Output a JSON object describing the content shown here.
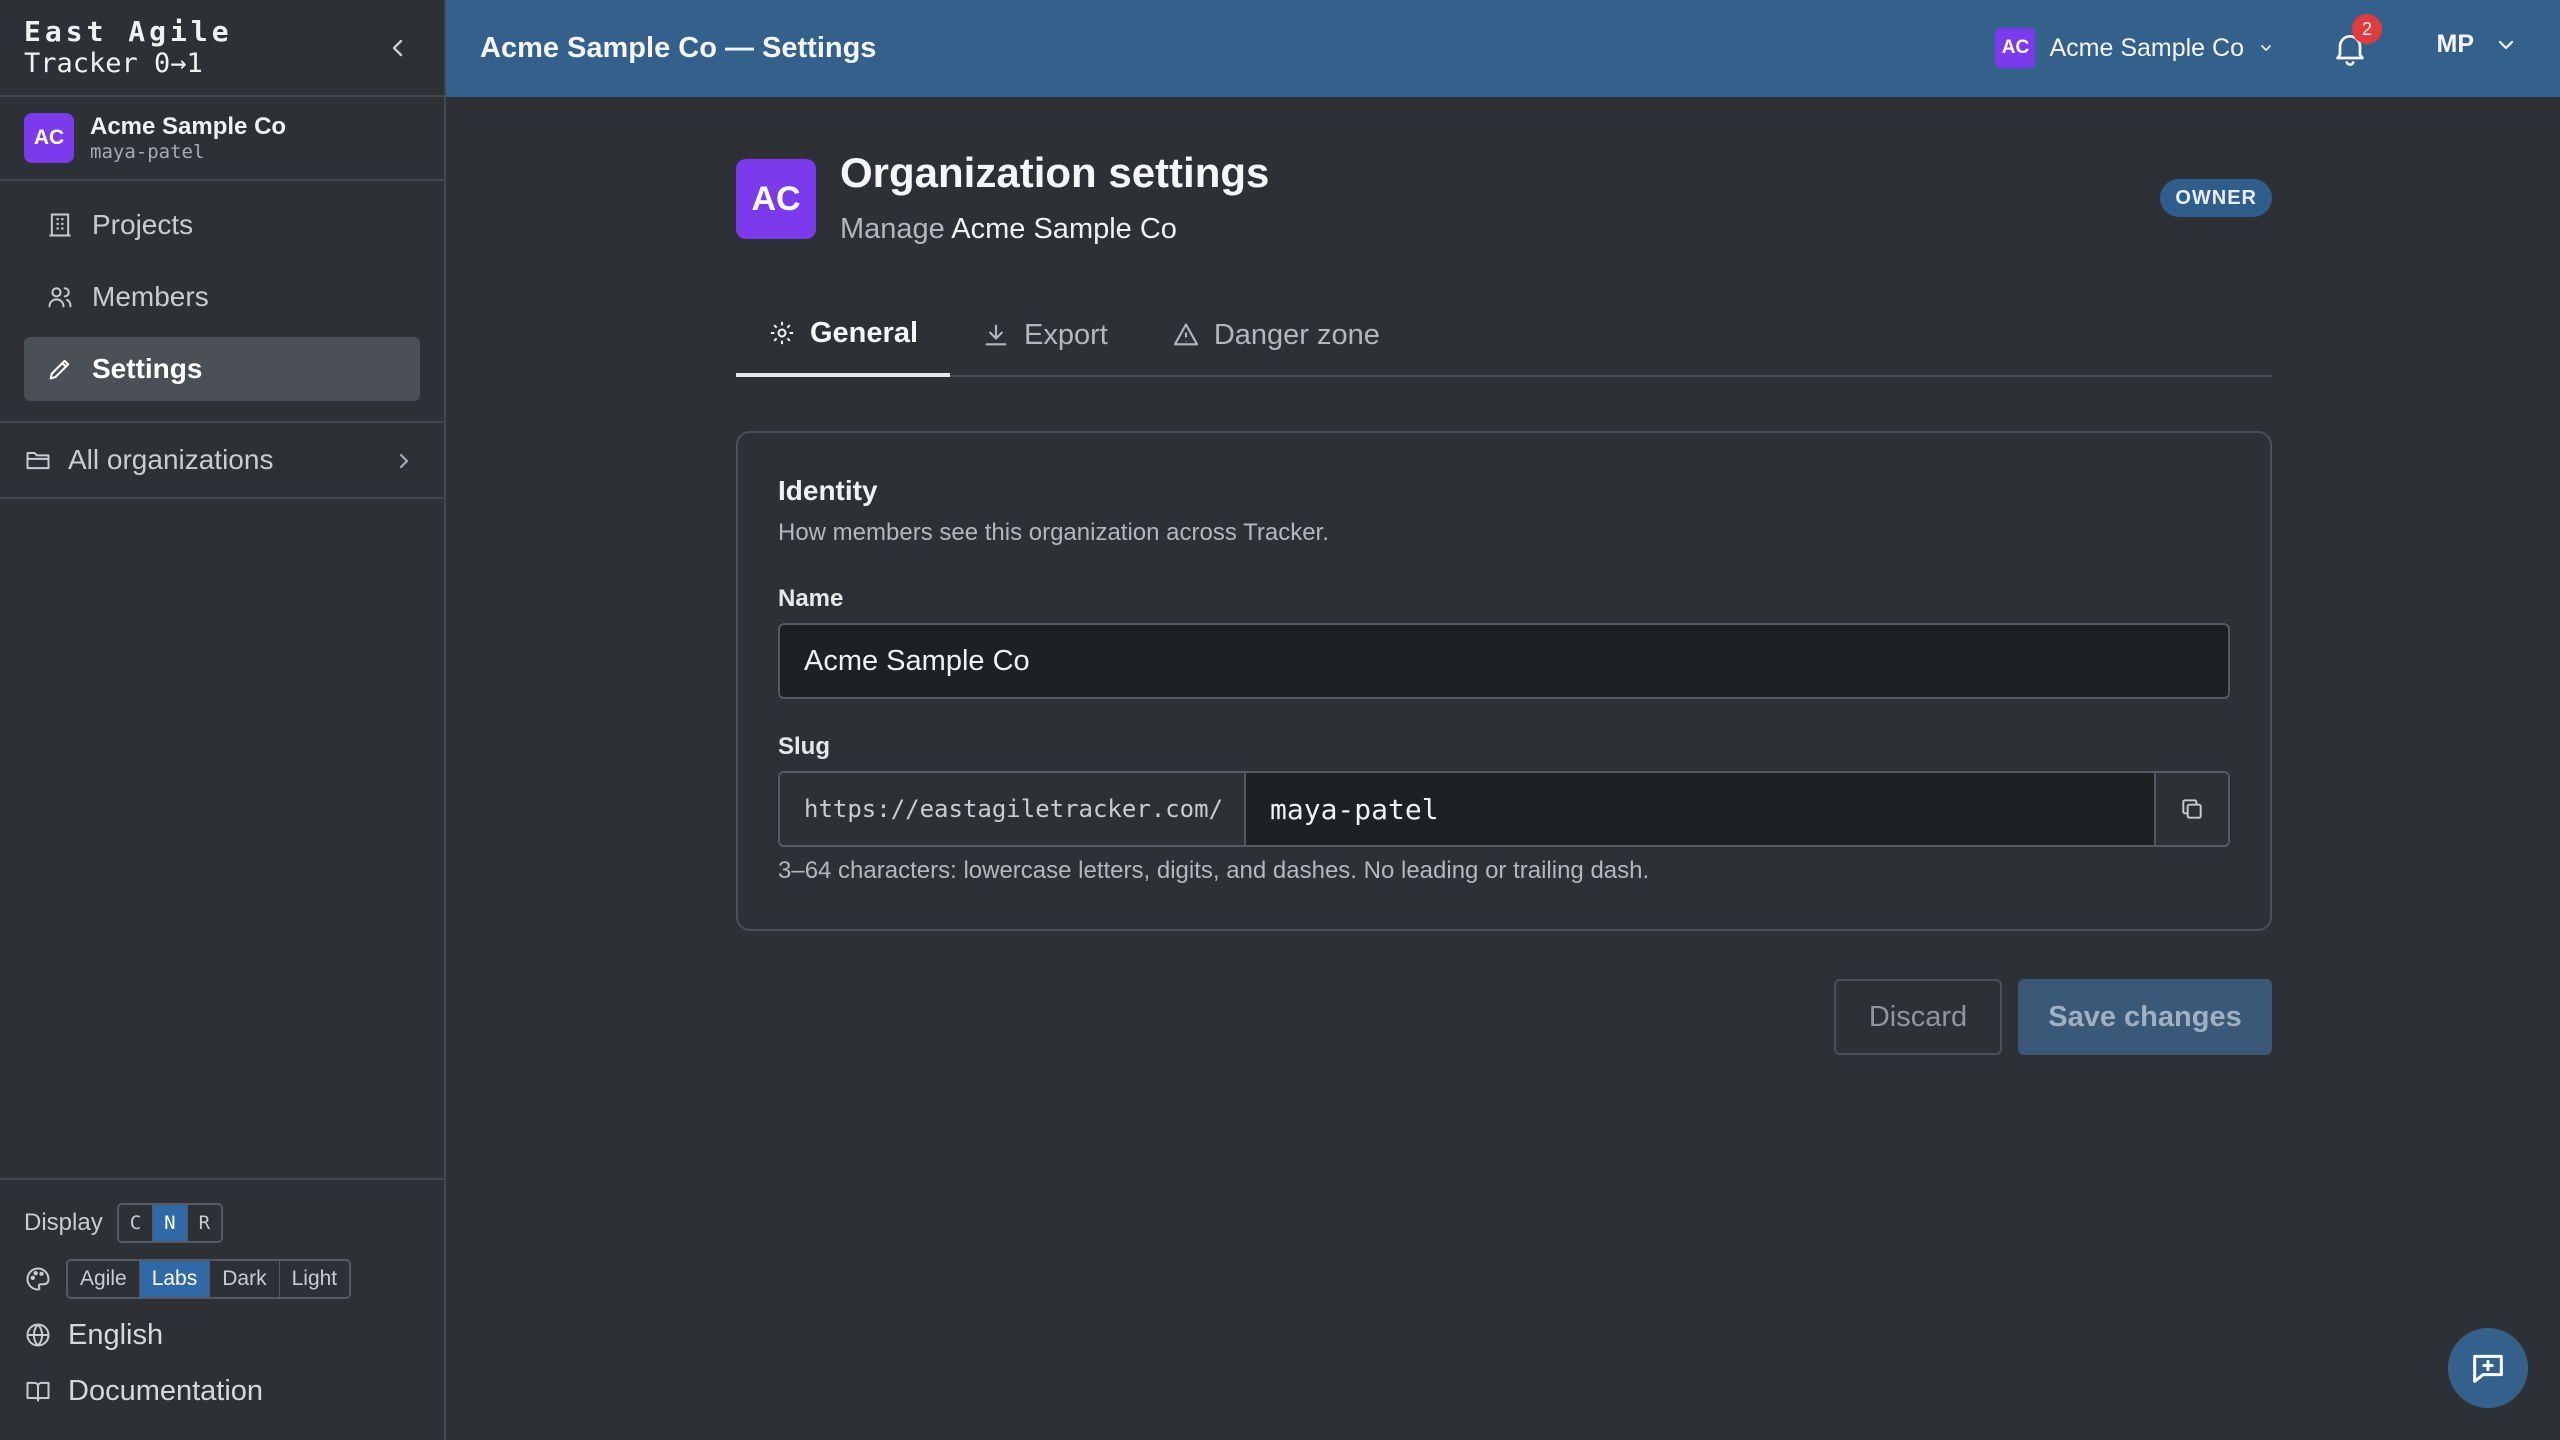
{
  "brand": {
    "line1": "East Agile",
    "line2": "Tracker 0→1"
  },
  "sidebar": {
    "org": {
      "initials": "AC",
      "name": "Acme Sample Co",
      "slug": "maya-patel"
    },
    "items": [
      {
        "label": "Projects",
        "icon": "building-icon"
      },
      {
        "label": "Members",
        "icon": "users-icon"
      },
      {
        "label": "Settings",
        "icon": "pencil-icon",
        "active": true
      }
    ],
    "all_orgs": "All organizations",
    "display": {
      "label": "Display",
      "options": [
        "C",
        "N",
        "R"
      ],
      "selected": "N"
    },
    "theme": {
      "options": [
        "Agile",
        "Labs",
        "Dark",
        "Light"
      ],
      "selected": "Labs"
    },
    "language": "English",
    "docs": "Documentation"
  },
  "topbar": {
    "title": "Acme Sample Co — Settings",
    "org_initials": "AC",
    "org_name": "Acme Sample Co",
    "notification_count": "2",
    "user_initials": "MP"
  },
  "header": {
    "initials": "AC",
    "title": "Organization settings",
    "subtitle_prefix": "Manage",
    "subtitle_org": "Acme Sample Co",
    "role_badge": "OWNER"
  },
  "tabs": [
    {
      "label": "General",
      "icon": "gear-icon",
      "active": true
    },
    {
      "label": "Export",
      "icon": "download-icon"
    },
    {
      "label": "Danger zone",
      "icon": "warning-icon"
    }
  ],
  "identity": {
    "title": "Identity",
    "description": "How members see this organization across Tracker.",
    "name_label": "Name",
    "name_value": "Acme Sample Co",
    "slug_label": "Slug",
    "slug_prefix": "https://eastagiletracker.com/",
    "slug_value": "maya-patel",
    "slug_help": "3–64 characters: lowercase letters, digits, and dashes. No leading or trailing dash."
  },
  "actions": {
    "discard": "Discard",
    "save": "Save changes"
  },
  "colors": {
    "topbar": "#34618c",
    "accent": "#2f6aa6",
    "avatar": "#7c3aed",
    "badge": "#e23b3b"
  }
}
